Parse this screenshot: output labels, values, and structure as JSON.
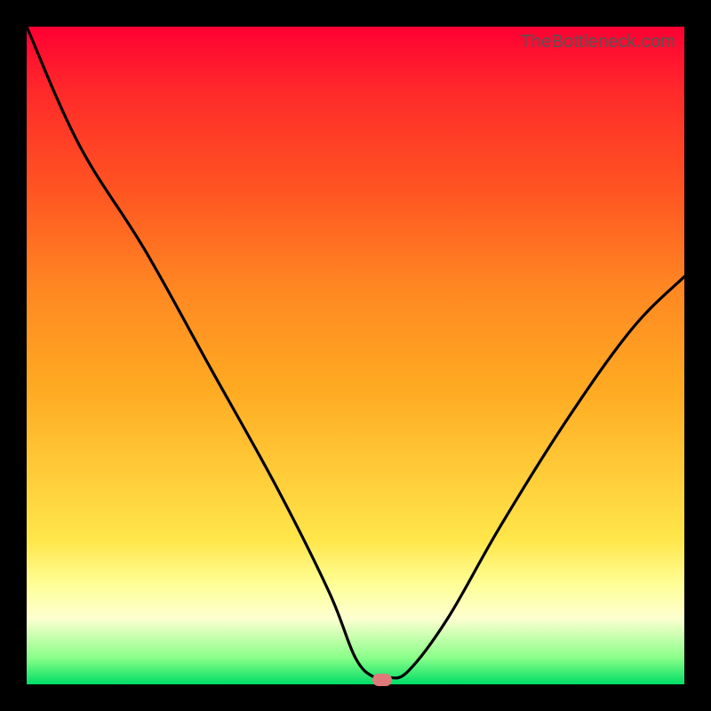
{
  "watermark": "TheBottleneck.com",
  "colors": {
    "frame": "#000000",
    "curve": "#000000",
    "marker": "#e07a7a",
    "gradient": [
      "#ff0033",
      "#ff5522",
      "#ffaa22",
      "#ffee55",
      "#fdffd0",
      "#00dd66"
    ]
  },
  "chart_data": {
    "type": "line",
    "title": "",
    "xlabel": "",
    "ylabel": "",
    "xlim": [
      0,
      100
    ],
    "ylim": [
      0,
      100
    ],
    "grid": false,
    "series": [
      {
        "name": "bottleneck-curve",
        "x": [
          0,
          8,
          18,
          28,
          38,
          46,
          50,
          53,
          55,
          58,
          64,
          72,
          82,
          92,
          100
        ],
        "values": [
          100,
          82,
          66,
          48,
          30,
          14,
          4,
          1,
          1,
          2,
          10,
          24,
          40,
          54,
          62
        ]
      }
    ],
    "annotations": [
      {
        "name": "optimal-marker",
        "x": 54,
        "y": 0.7
      }
    ],
    "legend": false
  }
}
